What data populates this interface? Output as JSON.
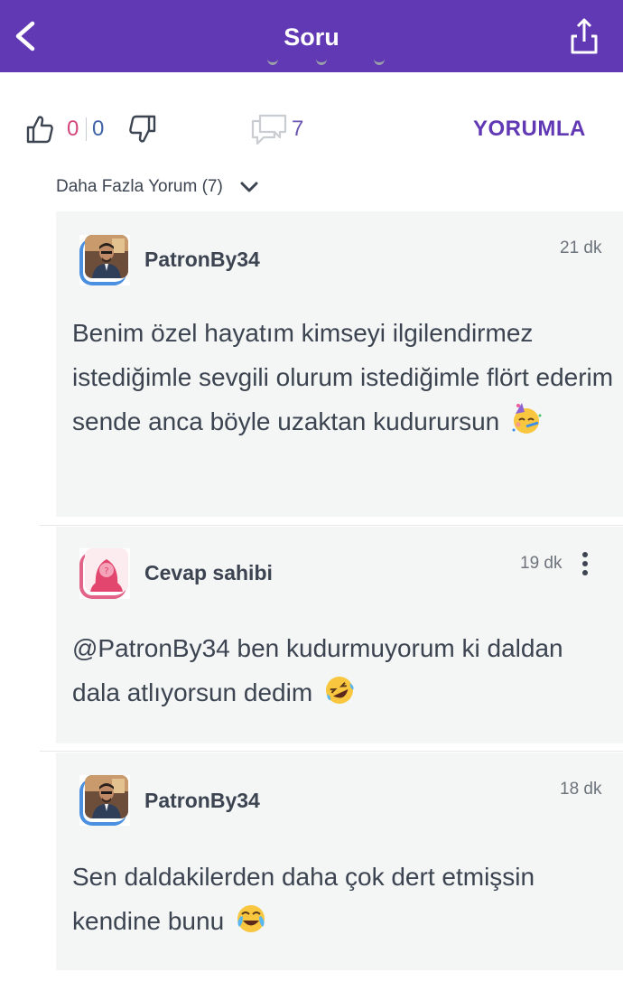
{
  "header": {
    "title": "Soru",
    "back_icon": "chevron-left-icon",
    "share_icon": "share-icon",
    "background": "#6239b5"
  },
  "actions": {
    "like_count": "0",
    "dislike_count": "0",
    "comment_count": "7",
    "comment_button": "YORUMLA",
    "like_color": "#d3467b",
    "dislike_color": "#3f63a6"
  },
  "more_comments": {
    "label": "Daha Fazla Yorum (7)"
  },
  "comments": [
    {
      "username": "PatronBy34",
      "time": "21 dk",
      "text": "Benim özel hayatım kimseyi ilgilendirmez istediğimle sevgili olurum istediğimle flört ederim sende anca böyle uzaktan kudurursun",
      "emoji": "partying-face",
      "avatar": "user-photo"
    },
    {
      "username": "Cevap sahibi",
      "time": "19 dk",
      "text": "@PatronBy34 ben kudurmuyorum ki daldan dala atlıyorsun dedim",
      "emoji": "rolling-on-floor-laughing",
      "avatar": "anonymous-female"
    },
    {
      "username": "PatronBy34",
      "time": "18 dk",
      "text": "Sen daldakilerden daha çok dert etmişsin kendine bunu",
      "emoji": "face-with-tears-of-joy",
      "avatar": "user-photo"
    }
  ]
}
